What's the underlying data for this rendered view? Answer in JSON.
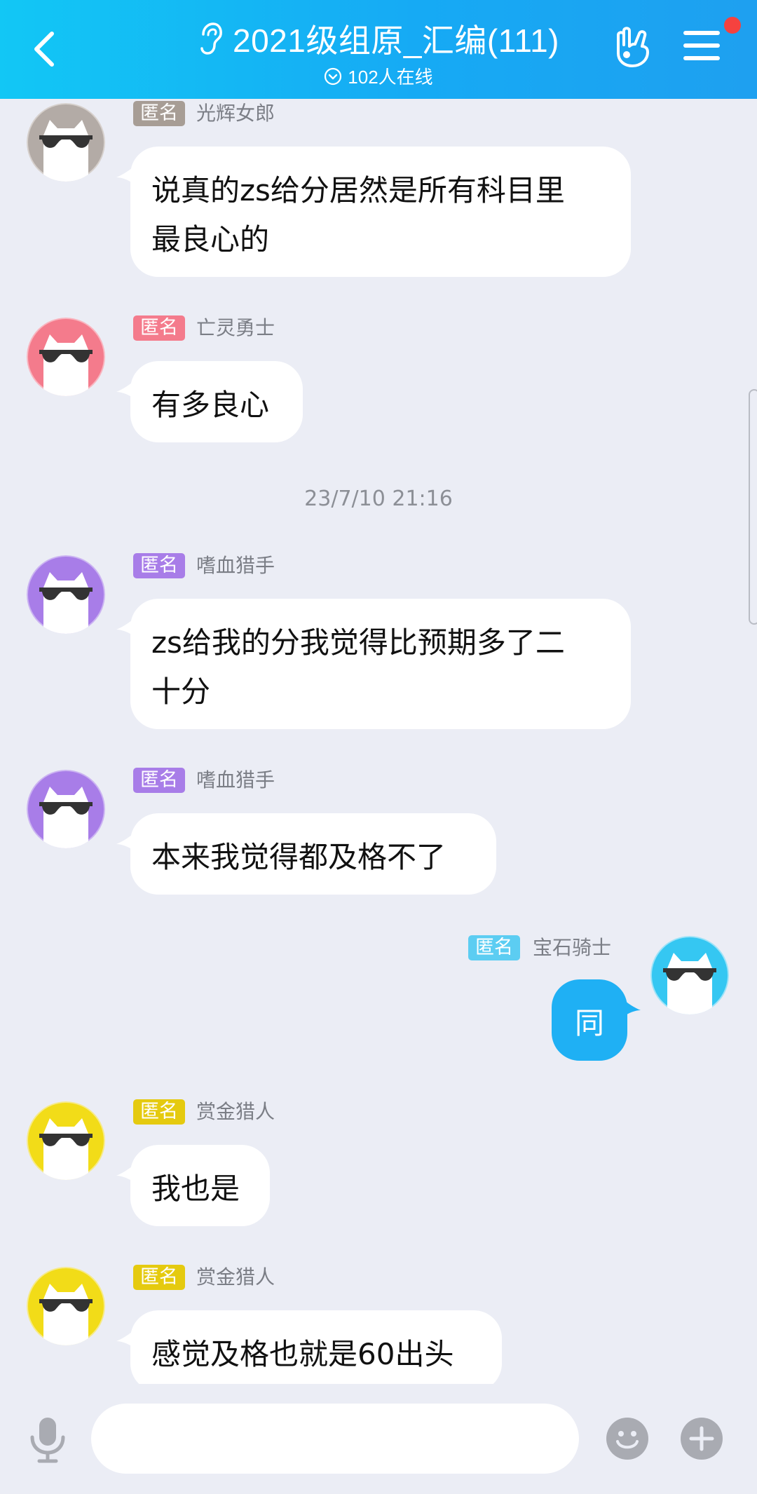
{
  "header": {
    "title": "2021级组原_汇编(111)",
    "online": "102人在线",
    "back_icon": "chevron-left-icon",
    "ear_icon": "ear-icon",
    "hand_icon": "hand-gesture-icon",
    "menu_icon": "hamburger-menu-icon",
    "gradient": [
      "#12c7f5",
      "#1ea0f0"
    ],
    "badge_color": "#f5423f"
  },
  "messages": [
    {
      "tag": "匿名",
      "nick": "光辉女郎",
      "text": [
        "说真的zs给分居然是所有科目里",
        "最良心的"
      ],
      "avatar_color": "#b3aba6",
      "tag_color": "#a79d95"
    },
    {
      "tag": "匿名",
      "nick": "亡灵勇士",
      "text": [
        "有多良心"
      ],
      "avatar_color": "#f47b8c",
      "tag_color": "#f47b8c"
    },
    {
      "timestamp": "23/7/10 21:16"
    },
    {
      "tag": "匿名",
      "nick": "嗜血猎手",
      "text": [
        "zs给我的分我觉得比预期多了二",
        "十分"
      ],
      "avatar_color": "#a87de8",
      "tag_color": "#a87de8"
    },
    {
      "tag": "匿名",
      "nick": "嗜血猎手",
      "text": [
        "本来我觉得都及格不了"
      ],
      "avatar_color": "#a87de8",
      "tag_color": "#a87de8"
    },
    {
      "tag": "匿名",
      "nick": "宝石骑士",
      "text": [
        "同"
      ],
      "avatar_color": "#35c7f2",
      "tag_color": "#5ccdf2",
      "self": true
    },
    {
      "tag": "匿名",
      "nick": "赏金猎人",
      "text": [
        "我也是"
      ],
      "avatar_color": "#f2dc18",
      "tag_color": "#e5ca0f"
    },
    {
      "tag": "匿名",
      "nick": "赏金猎人",
      "text": [
        "感觉及格也就是60出头"
      ],
      "avatar_color": "#f2dc18",
      "tag_color": "#e5ca0f"
    }
  ],
  "input": {
    "placeholder": "",
    "mic_icon": "microphone-icon",
    "emoji_icon": "smiley-icon",
    "plus_icon": "plus-icon"
  },
  "colors": {
    "background": "#ebedf5",
    "self_bubble": "#1fb0f4",
    "other_bubble": "#ffffff"
  }
}
